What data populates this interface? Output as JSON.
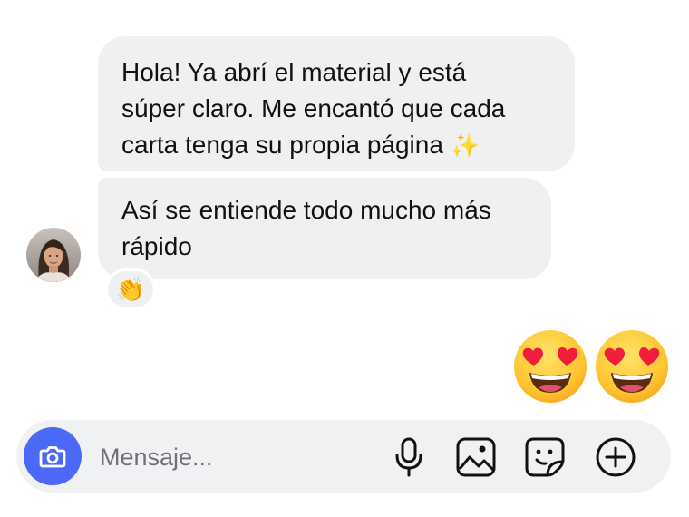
{
  "thread": {
    "messages": [
      {
        "text": "Hola! Ya abrí el material y está\nsúper claro. Me encantó que cada\ncarta tenga su propia página ",
        "trailing_emoji": "✨"
      },
      {
        "text": "Así se entiende todo mucho más\nrápido"
      }
    ],
    "reaction": {
      "emoji": "👏"
    },
    "sent_emojis": [
      "heart-eyes",
      "heart-eyes"
    ]
  },
  "composer": {
    "placeholder": "Mensaje...",
    "value": "",
    "icons": [
      "camera-icon",
      "microphone-icon",
      "image-icon",
      "sticker-icon",
      "plus-icon"
    ]
  },
  "colors": {
    "bubble_bg": "#eff0f2",
    "composer_bg": "#f0f1f3",
    "camera_accent": "#4c68f6",
    "icon_color": "#111111"
  }
}
